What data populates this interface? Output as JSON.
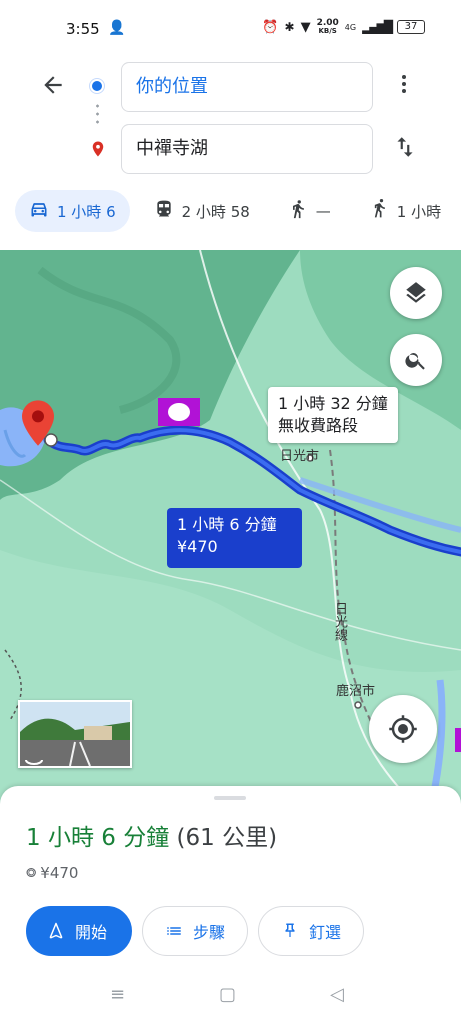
{
  "status": {
    "time": "3:55",
    "netspeed_value": "2.00",
    "netspeed_unit": "KB/S",
    "network": "4G",
    "battery": "37"
  },
  "search": {
    "origin": "你的位置",
    "destination": "中禪寺湖"
  },
  "modes": [
    {
      "icon": "car-icon",
      "label": "1 小時 6",
      "active": true
    },
    {
      "icon": "train-icon",
      "label": "2 小時 58",
      "active": false
    },
    {
      "icon": "walk-icon",
      "label": "—",
      "active": false
    },
    {
      "icon": "rideshare-icon",
      "label": "1 小時",
      "active": false
    }
  ],
  "map": {
    "alt_route_line1": "1 小時 32 分鐘",
    "alt_route_line2": "無收費路段",
    "main_route_line1": "1 小時 6 分鐘",
    "main_route_line2": "¥470",
    "label_nikko": "日光市",
    "label_nikko_line": "日光線",
    "label_kanuma": "鹿沼市"
  },
  "sheet": {
    "duration": "1 小時 6 分鐘",
    "distance": "(61 公里)",
    "toll": "¥470",
    "start_label": "開始",
    "steps_label": "步驟",
    "pin_label": "釘選"
  },
  "colors": {
    "accent": "#1a73e8",
    "route": "#1a3fcc",
    "duration_green": "#188038"
  }
}
